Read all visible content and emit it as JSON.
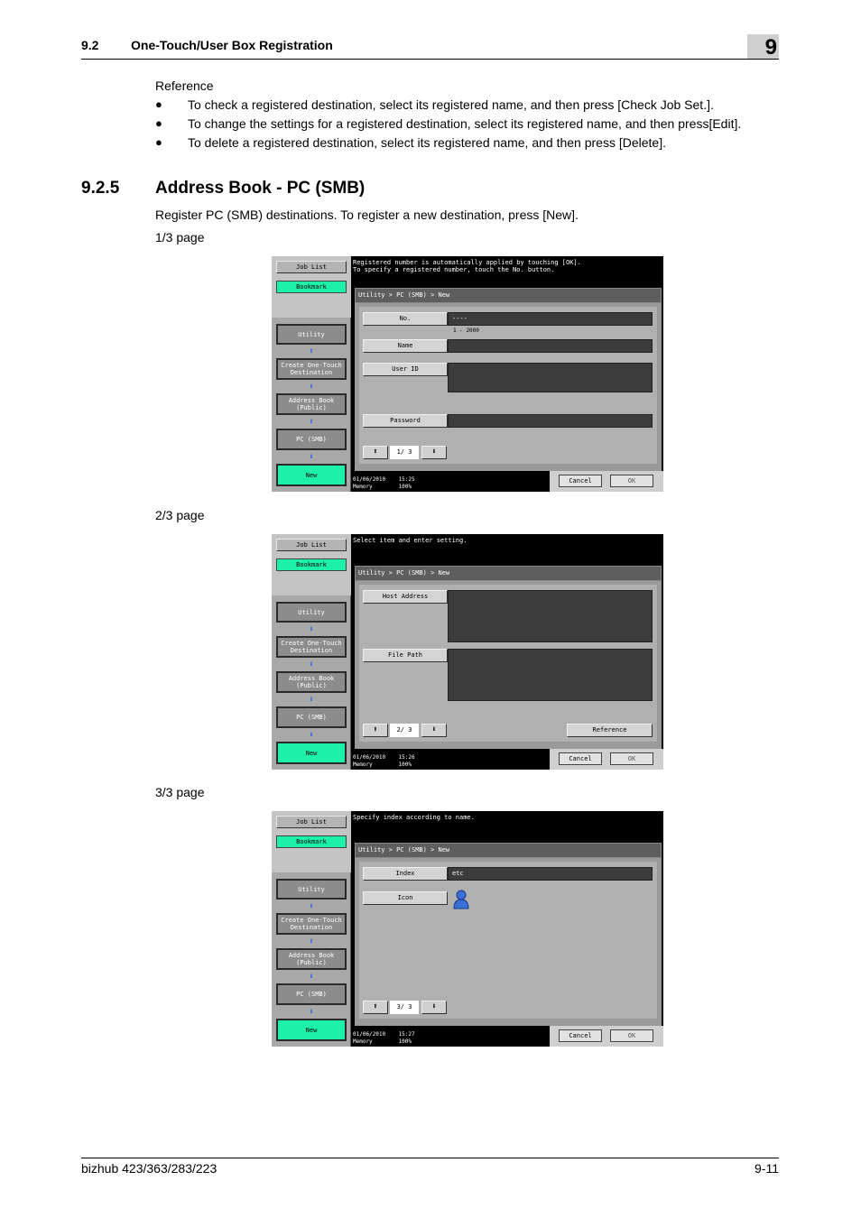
{
  "header": {
    "section": "9.2",
    "title": "One-Touch/User Box Registration",
    "chapter": "9"
  },
  "reference": {
    "label": "Reference",
    "bullets": [
      "To check a registered destination, select its registered name, and then press [Check Job Set.].",
      "To change the settings for a registered destination, select its registered name, and then press[Edit].",
      "To delete a registered destination, select its registered name, and then press [Delete]."
    ]
  },
  "section": {
    "number": "9.2.5",
    "title": "Address Book - PC (SMB)",
    "intro": "Register PC (SMB) destinations. To register a new destination, press [New].",
    "page1_label": "1/3 page",
    "page2_label": "2/3 page",
    "page3_label": "3/3 page"
  },
  "left_buttons": {
    "job_list": "Job List",
    "bookmark": "Bookmark",
    "utility": "Utility",
    "create": "Create One-Touch\nDestination",
    "address_book": "Address Book\n(Public)",
    "pc_smb": "PC (SMB)",
    "new": "New",
    "arrow": "⬇"
  },
  "common": {
    "breadcrumb": "Utility > PC (SMB) > New",
    "cancel": "Cancel",
    "ok": "OK",
    "up": "⬆",
    "down": "⬇"
  },
  "screen1": {
    "message": "Registered number is automatically applied by touching [OK].\nTo specify a registered number, touch the No. button.",
    "no_label": "No.",
    "no_value": "----",
    "no_range": "1 - 2000",
    "name_label": "Name",
    "userid_label": "User ID",
    "password_label": "Password",
    "page": "1/ 3",
    "status": "01/06/2010    15:25\nMemory        100%"
  },
  "screen2": {
    "message": "Select item and enter setting.",
    "host_label": "Host Address",
    "path_label": "File Path",
    "reference_label": "Reference",
    "page": "2/ 3",
    "status": "01/06/2010    15:26\nMemory        100%"
  },
  "screen3": {
    "message": "Specify index according to name.",
    "index_label": "Index",
    "index_value": "etc",
    "icon_label": "Icon",
    "page": "3/ 3",
    "status": "01/06/2010    15:27\nMemory        100%"
  },
  "footer": {
    "model": "bizhub 423/363/283/223",
    "page": "9-11"
  },
  "colors": {
    "green_button": "#1df0a8",
    "arrow_blue": "#2060f0",
    "panel_black": "#000000"
  }
}
